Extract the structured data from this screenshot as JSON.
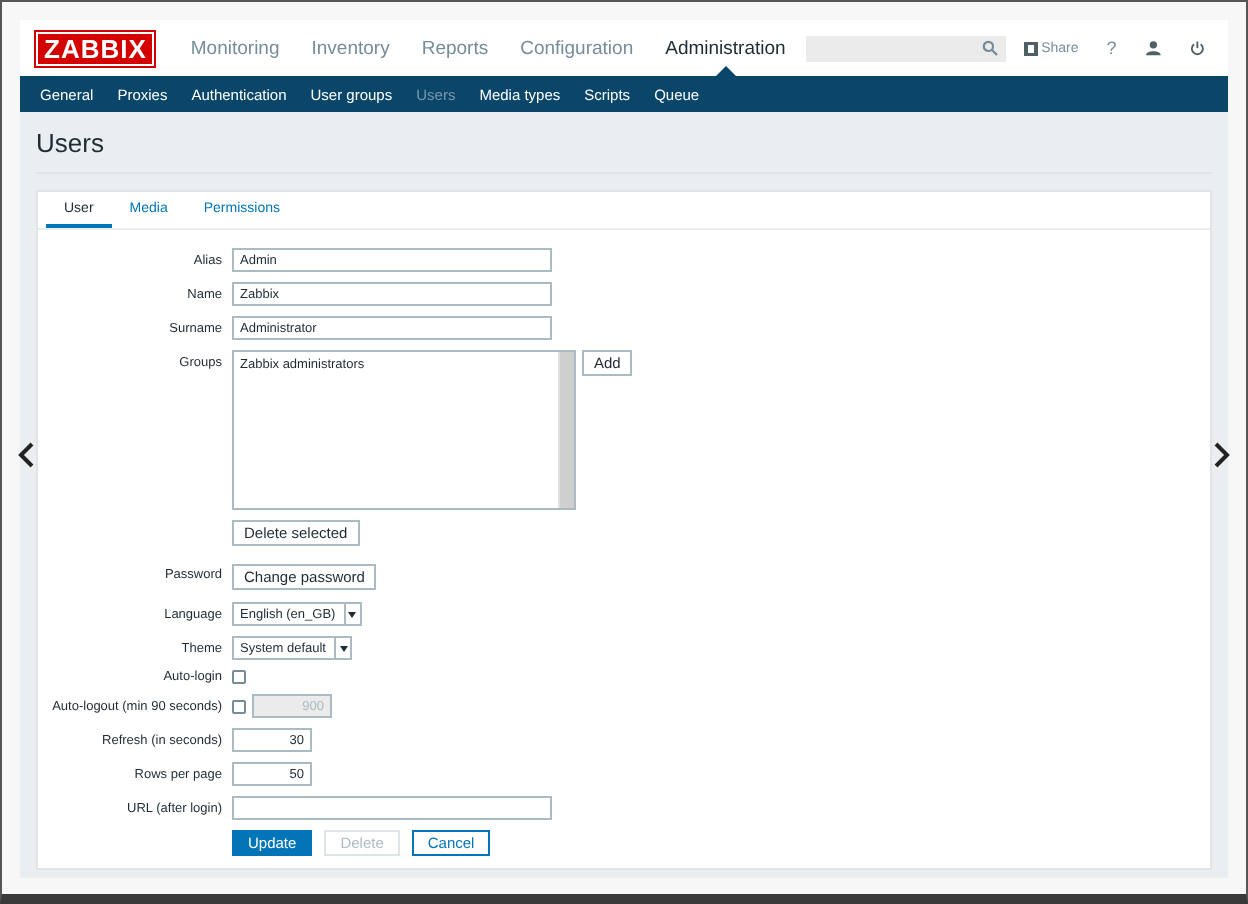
{
  "header": {
    "logo": "ZABBIX",
    "menu": [
      {
        "label": "Monitoring",
        "selected": false
      },
      {
        "label": "Inventory",
        "selected": false
      },
      {
        "label": "Reports",
        "selected": false
      },
      {
        "label": "Configuration",
        "selected": false
      },
      {
        "label": "Administration",
        "selected": true
      }
    ],
    "share": "Share",
    "help": "?"
  },
  "submenu": [
    {
      "label": "General",
      "selected": false
    },
    {
      "label": "Proxies",
      "selected": false
    },
    {
      "label": "Authentication",
      "selected": false
    },
    {
      "label": "User groups",
      "selected": false
    },
    {
      "label": "Users",
      "selected": true
    },
    {
      "label": "Media types",
      "selected": false
    },
    {
      "label": "Scripts",
      "selected": false
    },
    {
      "label": "Queue",
      "selected": false
    }
  ],
  "page_title": "Users",
  "tabs": [
    {
      "label": "User",
      "selected": true
    },
    {
      "label": "Media",
      "selected": false
    },
    {
      "label": "Permissions",
      "selected": false
    }
  ],
  "fields": [
    {
      "label": "Alias",
      "kind": "text",
      "value": "Admin"
    },
    {
      "label": "Name",
      "kind": "text",
      "value": "Zabbix"
    },
    {
      "label": "Surname",
      "kind": "text",
      "value": "Administrator"
    },
    {
      "label": "Groups",
      "kind": "listbox",
      "items": [
        "Zabbix administrators"
      ],
      "add_button": "Add",
      "remove_button": "Delete selected"
    },
    {
      "label": "Password",
      "kind": "button",
      "button": "Change password"
    },
    {
      "label": "Language",
      "kind": "select",
      "value": "English (en_GB)"
    },
    {
      "label": "Theme",
      "kind": "select",
      "value": "System default"
    },
    {
      "label": "Auto-login",
      "kind": "checkbox",
      "checked": false
    },
    {
      "label": "Auto-logout (min 90 seconds)",
      "kind": "checkbox_number",
      "checked": false,
      "value": "900",
      "disabled": true
    },
    {
      "label": "Refresh (in seconds)",
      "kind": "number",
      "value": "30"
    },
    {
      "label": "Rows per page",
      "kind": "number",
      "value": "50"
    },
    {
      "label": "URL (after login)",
      "kind": "text"
    }
  ],
  "actions": [
    {
      "label": "Update",
      "kind": "primary"
    },
    {
      "label": "Delete",
      "kind": "disabled"
    },
    {
      "label": "Cancel",
      "kind": "secondary"
    }
  ]
}
